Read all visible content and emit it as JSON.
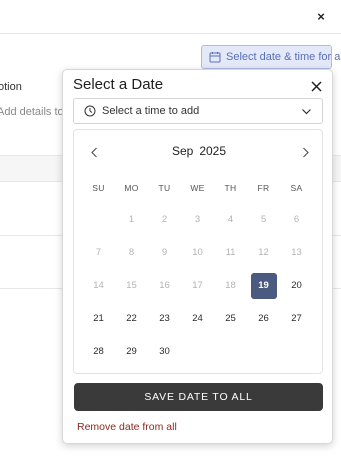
{
  "background": {
    "close_glyph": "×",
    "select_button_label": "Select date & time for all",
    "field_label": "otion",
    "field_hint": "Add details to a"
  },
  "popup": {
    "title": "Select a Date",
    "time_select": {
      "placeholder": "Select a time to add"
    },
    "calendar": {
      "month": "Sep",
      "year": "2025",
      "weekdays": [
        "SU",
        "MO",
        "TU",
        "WE",
        "TH",
        "FR",
        "SA"
      ],
      "leading_blanks": 1,
      "days": [
        {
          "n": "1",
          "state": "disabled"
        },
        {
          "n": "2",
          "state": "disabled"
        },
        {
          "n": "3",
          "state": "disabled"
        },
        {
          "n": "4",
          "state": "disabled"
        },
        {
          "n": "5",
          "state": "disabled"
        },
        {
          "n": "6",
          "state": "disabled"
        },
        {
          "n": "7",
          "state": "disabled"
        },
        {
          "n": "8",
          "state": "disabled"
        },
        {
          "n": "9",
          "state": "disabled"
        },
        {
          "n": "10",
          "state": "disabled"
        },
        {
          "n": "11",
          "state": "disabled"
        },
        {
          "n": "12",
          "state": "disabled"
        },
        {
          "n": "13",
          "state": "disabled"
        },
        {
          "n": "14",
          "state": "disabled"
        },
        {
          "n": "15",
          "state": "disabled"
        },
        {
          "n": "16",
          "state": "disabled"
        },
        {
          "n": "17",
          "state": "disabled"
        },
        {
          "n": "18",
          "state": "disabled"
        },
        {
          "n": "19",
          "state": "selected"
        },
        {
          "n": "20",
          "state": "enabled"
        },
        {
          "n": "21",
          "state": "enabled"
        },
        {
          "n": "22",
          "state": "enabled"
        },
        {
          "n": "23",
          "state": "enabled"
        },
        {
          "n": "24",
          "state": "enabled"
        },
        {
          "n": "25",
          "state": "enabled"
        },
        {
          "n": "26",
          "state": "enabled"
        },
        {
          "n": "27",
          "state": "enabled"
        },
        {
          "n": "28",
          "state": "enabled"
        },
        {
          "n": "29",
          "state": "enabled"
        },
        {
          "n": "30",
          "state": "enabled"
        }
      ]
    },
    "save_button_label": "SAVE DATE TO ALL",
    "remove_link_label": "Remove date from all"
  },
  "icons": {
    "calendar": "calendar-icon",
    "clock": "clock-icon",
    "chevron_down": "chevron-down-icon",
    "chevron_left": "chevron-left-icon",
    "chevron_right": "chevron-right-icon",
    "close": "close-icon"
  },
  "colors": {
    "selected_day": "#4a5a80",
    "save_button": "#3a3a3a",
    "remove_link": "#8b2a1e",
    "select_button_bg": "#e3e9f9",
    "select_button_text": "#5a6fb5"
  }
}
